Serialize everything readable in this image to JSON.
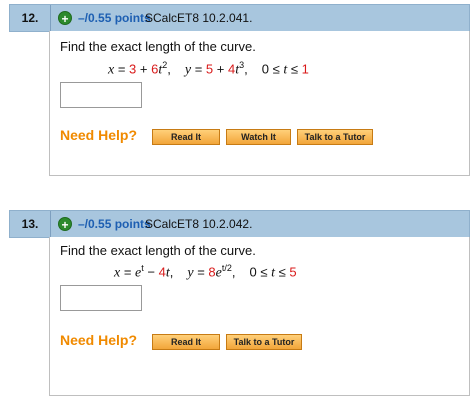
{
  "questions": [
    {
      "number": "12.",
      "points": "–/0.55 points",
      "code": "SCalcET8 10.2.041.",
      "prompt": "Find the exact length of the curve.",
      "formula": {
        "x_lhs": "x",
        "x_eq": " = ",
        "x_c1": "3",
        "x_plus": " + ",
        "x_c2": "6",
        "x_var": "t",
        "x_exp": "2",
        "sep1": ",",
        "y_lhs": "y",
        "y_eq": " = ",
        "y_c1": "5",
        "y_plus": " + ",
        "y_c2": "4",
        "y_var": "t",
        "y_exp": "3",
        "sep2": ",",
        "lo": "0",
        "le1": " ≤ ",
        "t": "t",
        "le2": " ≤ ",
        "hi": "1"
      },
      "answer_value": "",
      "need_help": "Need Help?",
      "buttons": [
        "Read It",
        "Watch It",
        "Talk to a Tutor"
      ]
    },
    {
      "number": "13.",
      "points": "–/0.55 points",
      "code": "SCalcET8 10.2.042.",
      "prompt": "Find the exact length of the curve.",
      "formula": {
        "x_lhs": "x",
        "x_eq": " = ",
        "x_e": "e",
        "x_exp": "t",
        "x_minus": " − ",
        "x_c": "4",
        "x_var": "t",
        "sep1": ",",
        "y_lhs": "y",
        "y_eq": " = ",
        "y_c": "8",
        "y_e": "e",
        "y_exp": "t/2",
        "sep2": ",",
        "lo": "0",
        "le1": " ≤ ",
        "t": "t",
        "le2": " ≤ ",
        "hi": "5"
      },
      "answer_value": "",
      "need_help": "Need Help?",
      "buttons": [
        "Read It",
        "Talk to a Tutor"
      ]
    }
  ],
  "colors": {
    "header_bg": "#a8c6de",
    "points_text": "#1d5fb2",
    "need_help": "#f08a00",
    "red_value": "#d91a1a",
    "button": "#f2a53a"
  },
  "icons": {
    "points_badge": "plus-circle-icon"
  }
}
